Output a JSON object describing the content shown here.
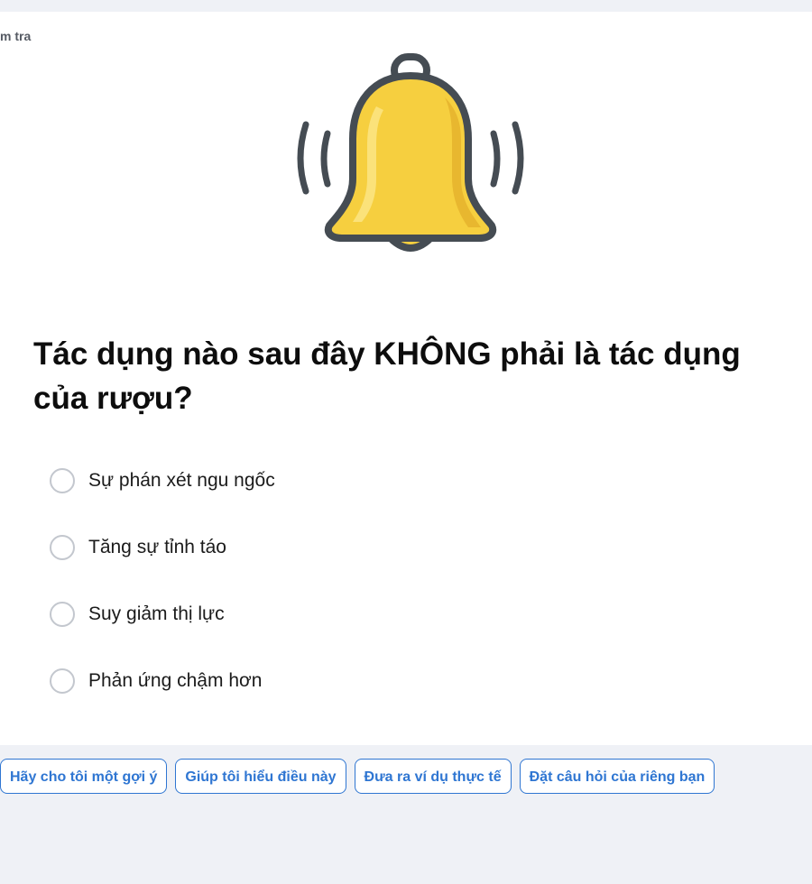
{
  "card": {
    "header_label": "m tra"
  },
  "illustration": {
    "icon": "bell-icon"
  },
  "question": {
    "text": "Tác dụng nào sau đây KHÔNG phải là tác dụng của rượu?"
  },
  "options": [
    {
      "label": "Sự phán xét ngu ngốc",
      "selected": false
    },
    {
      "label": "Tăng sự tỉnh táo",
      "selected": false
    },
    {
      "label": "Suy giảm thị lực",
      "selected": false
    },
    {
      "label": "Phản ứng chậm hơn",
      "selected": false
    }
  ],
  "suggestions": [
    {
      "label": "Hãy cho tôi một gợi ý"
    },
    {
      "label": "Giúp tôi hiểu điều này"
    },
    {
      "label": "Đưa ra ví dụ thực tế"
    },
    {
      "label": "Đặt câu hỏi của riêng bạn"
    }
  ],
  "colors": {
    "page_background": "#eff1f6",
    "card_background": "#ffffff",
    "accent_blue": "#2f76d2",
    "bell_yellow": "#f6cf3f",
    "bell_outline": "#454c53"
  }
}
